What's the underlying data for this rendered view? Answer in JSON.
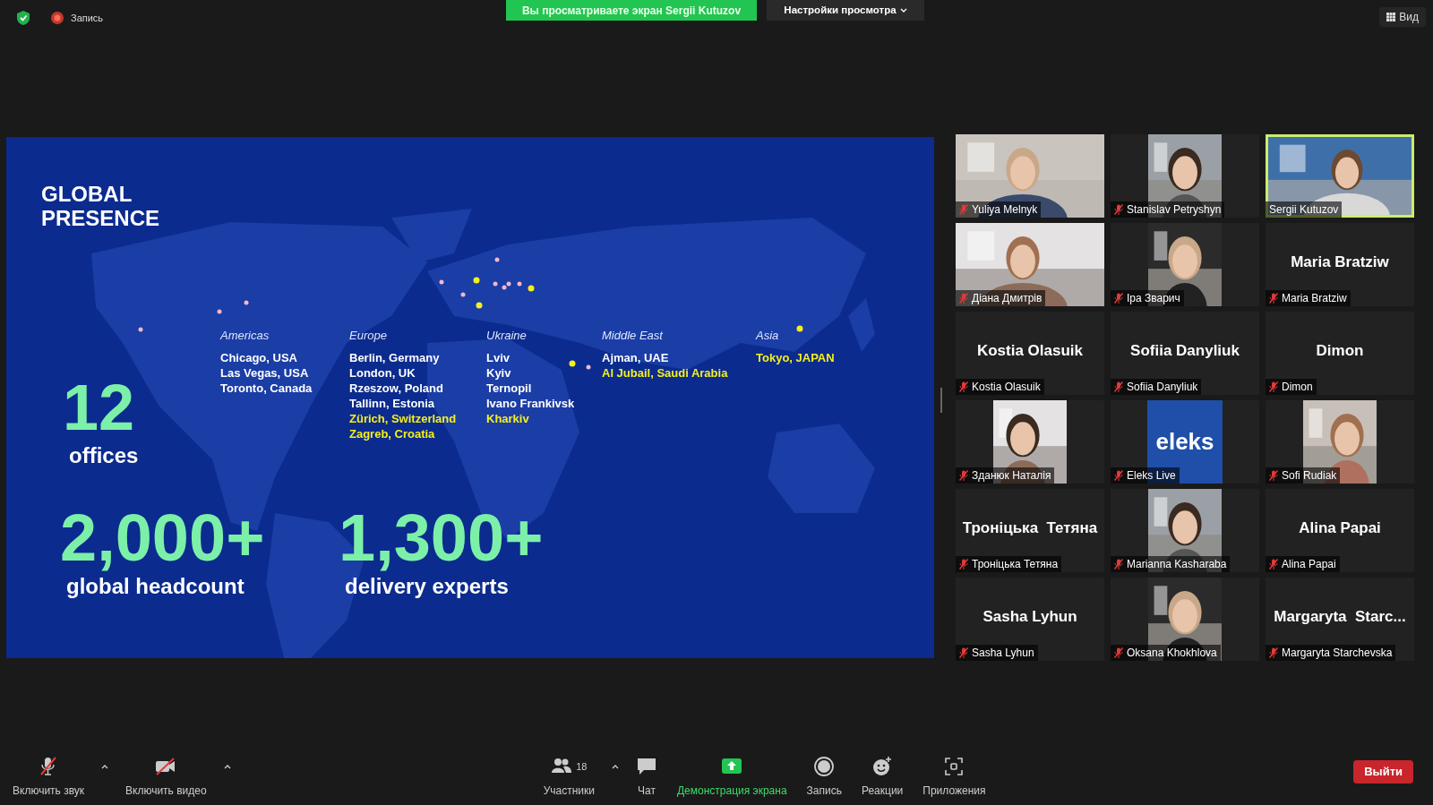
{
  "top_bar": {
    "recording_label": "Запись",
    "share_banner": "Вы просматриваете экран Sergii Kutuzov",
    "view_options": "Настройки просмотра",
    "view_button": "Вид"
  },
  "slide": {
    "title": "GLOBAL PRESENCE",
    "regions": [
      {
        "name": "Americas",
        "cities": [
          {
            "text": "Chicago, USA",
            "highlight": false
          },
          {
            "text": "Las Vegas, USA",
            "highlight": false
          },
          {
            "text": "Toronto, Canada",
            "highlight": false
          }
        ]
      },
      {
        "name": "Europe",
        "cities": [
          {
            "text": "Berlin, Germany",
            "highlight": false
          },
          {
            "text": "London, UK",
            "highlight": false
          },
          {
            "text": "Rzeszow, Poland",
            "highlight": false
          },
          {
            "text": "Tallinn, Estonia",
            "highlight": false
          },
          {
            "text": "Zürich, Switzerland",
            "highlight": true
          },
          {
            "text": "Zagreb, Croatia",
            "highlight": true
          }
        ]
      },
      {
        "name": "Ukraine",
        "cities": [
          {
            "text": "Lviv",
            "highlight": false
          },
          {
            "text": "Kyiv",
            "highlight": false
          },
          {
            "text": "Ternopil",
            "highlight": false
          },
          {
            "text": "Ivano Frankivsk",
            "highlight": false
          },
          {
            "text": "Kharkiv",
            "highlight": true
          }
        ]
      },
      {
        "name": "Middle East",
        "cities": [
          {
            "text": "Ajman, UAE",
            "highlight": false
          },
          {
            "text": "Al Jubail, Saudi Arabia",
            "highlight": true
          }
        ]
      },
      {
        "name": "Asia",
        "cities": [
          {
            "text": "Tokyo, JAPAN",
            "highlight": true
          }
        ]
      }
    ],
    "stats": [
      {
        "value": "12",
        "label": "offices"
      },
      {
        "value": "2,000+",
        "label": "global headcount"
      },
      {
        "value": "1,300+",
        "label": "delivery experts"
      }
    ]
  },
  "tiles": [
    {
      "kind": "video",
      "name": "Yuliya Melnyk",
      "muted": true,
      "speaking": false
    },
    {
      "kind": "portrait",
      "name": "Stanislav Petryshyn",
      "muted": true,
      "speaking": false
    },
    {
      "kind": "video",
      "name": "Sergii Kutuzov",
      "muted": false,
      "speaking": true
    },
    {
      "kind": "video",
      "name": "Діана Дмитрів",
      "muted": true,
      "speaking": false
    },
    {
      "kind": "portrait",
      "name": "Іра Зварич",
      "muted": true,
      "speaking": false
    },
    {
      "kind": "name",
      "display_name": "Maria Bratziw",
      "name": "Maria Bratziw",
      "muted": true,
      "speaking": false
    },
    {
      "kind": "name",
      "display_name": "Kostia Olasuik",
      "name": "Kostia Olasuik",
      "muted": true,
      "speaking": false
    },
    {
      "kind": "name",
      "display_name": "Sofiia Danyliuk",
      "name": "Sofiia Danyliuk",
      "muted": true,
      "speaking": false
    },
    {
      "kind": "name",
      "display_name": "Dimon",
      "name": "Dimon",
      "muted": true,
      "speaking": false
    },
    {
      "kind": "portrait",
      "name": "Зданюк Наталія",
      "muted": true,
      "speaking": false
    },
    {
      "kind": "logo",
      "logo_text": "eleks",
      "name": "Eleks Live",
      "muted": true,
      "speaking": false
    },
    {
      "kind": "portrait",
      "name": "Sofi Rudiak",
      "muted": true,
      "speaking": false
    },
    {
      "kind": "name",
      "display_name": "Троніцька  Тетяна",
      "name": "Троніцька Тетяна",
      "muted": true,
      "speaking": false
    },
    {
      "kind": "portrait",
      "name": "Marianna Kasharaba",
      "muted": true,
      "speaking": false
    },
    {
      "kind": "name",
      "display_name": "Alina Papai",
      "name": "Alina Papai",
      "muted": true,
      "speaking": false
    },
    {
      "kind": "name",
      "display_name": "Sasha Lyhun",
      "name": "Sasha Lyhun",
      "muted": true,
      "speaking": false
    },
    {
      "kind": "portrait",
      "name": "Oksana Khokhlova",
      "muted": true,
      "speaking": false
    },
    {
      "kind": "name",
      "display_name": "Margaryta  Starc...",
      "name": "Margaryta Starchevska",
      "muted": true,
      "speaking": false
    }
  ],
  "toolbar": [
    {
      "kind": "mic",
      "label": "Включить звук",
      "caret": true
    },
    {
      "kind": "camera",
      "label": "Включить видео",
      "caret": true
    },
    {
      "kind": "participants",
      "label": "Участники",
      "count": "18",
      "caret": true
    },
    {
      "kind": "chat",
      "label": "Чат",
      "caret": false
    },
    {
      "kind": "share",
      "label": "Демонстрация экрана",
      "caret": false
    },
    {
      "kind": "record",
      "label": "Запись",
      "caret": false
    },
    {
      "kind": "reactions",
      "label": "Реакции",
      "caret": false
    },
    {
      "kind": "apps",
      "label": "Приложения",
      "caret": false
    }
  ],
  "leave_button": "Выйти"
}
